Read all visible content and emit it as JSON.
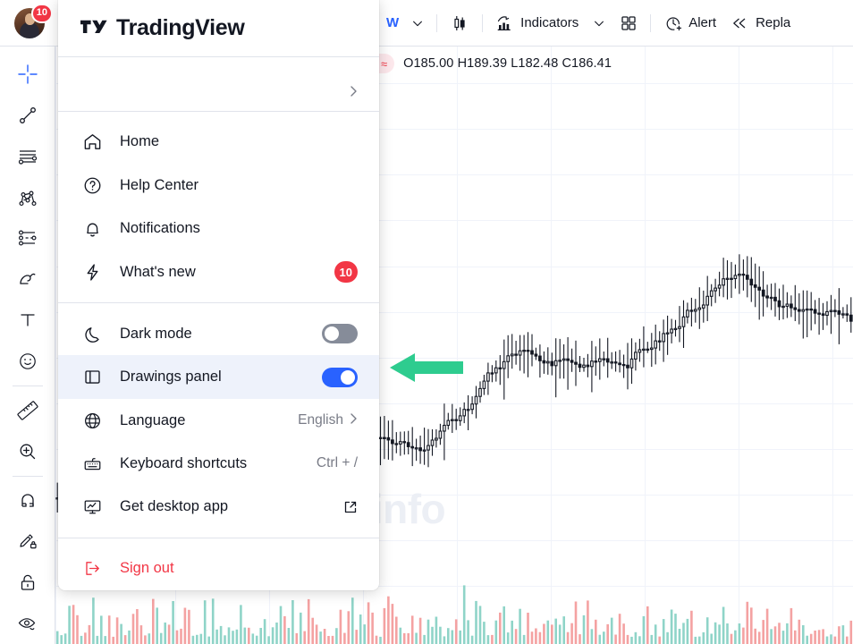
{
  "topbar": {
    "avatar_badge": "10",
    "timeframe": "W",
    "indicators_label": "Indicators",
    "alert_label": "Alert",
    "replay_label": "Repla",
    "icons": {
      "timeframe_chevron": "chevron-down-icon",
      "candle_type": "candlestick-icon",
      "indicators_chevron": "chevron-down-icon",
      "layout_grid": "grid-layout-icon",
      "alert": "alarm-clock-plus-icon",
      "replay": "rewind-icon"
    }
  },
  "left_toolbar": {
    "tools": [
      {
        "name": "cursor-crosshair-tool",
        "active": true
      },
      {
        "name": "trend-line-tool",
        "active": false
      },
      {
        "name": "horizontal-lines-tool",
        "active": false
      },
      {
        "name": "pitchfork-tool",
        "active": false
      },
      {
        "name": "fib-projection-tool",
        "active": false
      },
      {
        "name": "brush-tool",
        "active": false
      },
      {
        "name": "text-tool",
        "active": false
      },
      {
        "name": "emoji-tool",
        "active": false
      },
      {
        "name": "measure-ruler-tool",
        "active": false
      },
      {
        "name": "zoom-in-tool",
        "active": false
      },
      {
        "name": "magnet-tool",
        "active": false
      },
      {
        "name": "stay-in-drawing-mode-tool",
        "active": false
      },
      {
        "name": "lock-drawings-tool",
        "active": false
      },
      {
        "name": "hide-drawings-tool",
        "active": false
      }
    ]
  },
  "chart": {
    "ohlc": "O185.00 H189.39 L182.48 C186.41",
    "watermark": "ChungkhoanMy.info",
    "pill_left_icon": "dash-icon",
    "pill_right_icon": "approximately-equal-icon",
    "flag_icon": "flag-icon"
  },
  "menu": {
    "brand": "TradingView",
    "brand_logo_icon": "tradingview-logo-icon",
    "user_row_chevron": "chevron-right-icon",
    "groups": [
      {
        "items": [
          {
            "icon": "home-icon",
            "label": "Home",
            "badge": null,
            "right": null,
            "toggle": null,
            "highlight": false,
            "danger": false
          },
          {
            "icon": "help-circle-icon",
            "label": "Help Center",
            "badge": null,
            "right": null,
            "toggle": null,
            "highlight": false,
            "danger": false
          },
          {
            "icon": "bell-icon",
            "label": "Notifications",
            "badge": null,
            "right": null,
            "toggle": null,
            "highlight": false,
            "danger": false
          },
          {
            "icon": "lightning-bolt-icon",
            "label": "What's new",
            "badge": "10",
            "right": null,
            "toggle": null,
            "highlight": false,
            "danger": false
          }
        ]
      },
      {
        "items": [
          {
            "icon": "moon-icon",
            "label": "Dark mode",
            "badge": null,
            "right": null,
            "toggle": "off",
            "highlight": false,
            "danger": false
          },
          {
            "icon": "panel-left-icon",
            "label": "Drawings panel",
            "badge": null,
            "right": null,
            "toggle": "on",
            "highlight": true,
            "danger": false
          },
          {
            "icon": "globe-icon",
            "label": "Language",
            "badge": null,
            "right": "English",
            "right_chevron": "chevron-right-icon",
            "toggle": null,
            "highlight": false,
            "danger": false
          },
          {
            "icon": "keyboard-icon",
            "label": "Keyboard shortcuts",
            "badge": null,
            "right": "Ctrl + /",
            "toggle": null,
            "highlight": false,
            "danger": false
          },
          {
            "icon": "desktop-chart-icon",
            "label": "Get desktop app",
            "badge": null,
            "right": null,
            "right_icon": "external-link-icon",
            "toggle": null,
            "highlight": false,
            "danger": false
          }
        ]
      },
      {
        "items": [
          {
            "icon": "sign-out-icon",
            "label": "Sign out",
            "badge": null,
            "right": null,
            "toggle": null,
            "highlight": false,
            "danger": true
          }
        ]
      }
    ]
  },
  "annotation": {
    "arrow_color": "#2ecc8f",
    "arrow_direction": "left",
    "points_to": "drawings-panel-toggle"
  },
  "colors": {
    "accent_blue": "#2962ff",
    "danger_red": "#f23645",
    "grid": "#f0f3fa",
    "border": "#e0e3eb",
    "text": "#131722",
    "muted": "#787b86",
    "volume_up": "#8fd4c8",
    "volume_down": "#f4a2a2",
    "highlight_row": "#eef2fb"
  },
  "chart_data": {
    "type": "candlestick",
    "title": "",
    "xlabel": "",
    "ylabel": "",
    "grid": true,
    "ohlc_display": {
      "open": 185.0,
      "high": 189.39,
      "low": 182.48,
      "close": 186.41
    },
    "timeframe": "W",
    "note": "Weekly hollow candlestick chart with volume histogram; price trends upward from left to right."
  }
}
